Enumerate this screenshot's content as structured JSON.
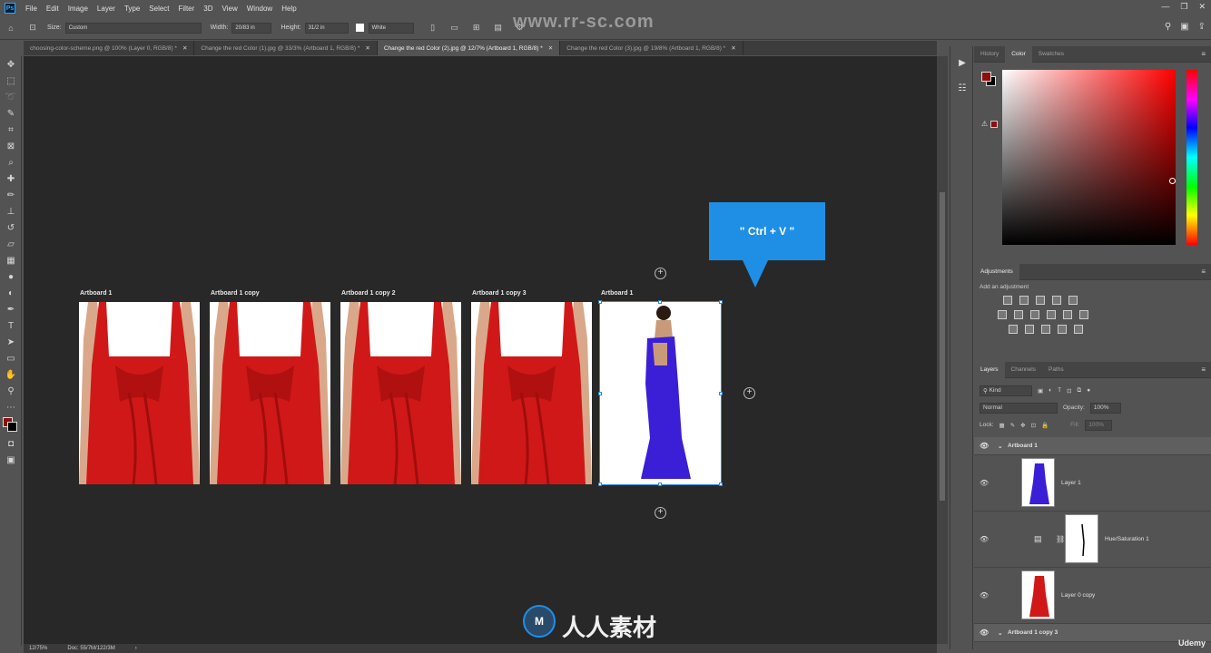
{
  "menubar": {
    "items": [
      "File",
      "Edit",
      "Image",
      "Layer",
      "Type",
      "Select",
      "Filter",
      "3D",
      "View",
      "Window",
      "Help"
    ]
  },
  "options": {
    "size_label": "Size:",
    "size_value": "Custom",
    "width_label": "Width:",
    "width_value": "20/83 in",
    "height_label": "Height:",
    "height_value": "31/2 in",
    "bg_value": "White"
  },
  "watermark_url": "www.rr-sc.com",
  "tabs": [
    "choosing-color-scheme.png @ 100% (Layer 0, RGB/8) *",
    "Change the red Color (1).jpg @ 33/3% (Artboard 1, RGB/8) *",
    "Change the red Color (2).jpg @ 12/7% (Artboard 1, RGB/8) *",
    "Change the red Color (3).jpg @ 19/8% (Artboard 1, RGB/8) *"
  ],
  "artboards": [
    "Artboard 1",
    "Artboard 1 copy",
    "Artboard 1 copy 2",
    "Artboard 1 copy 3",
    "Artboard 1"
  ],
  "callout": "\" Ctrl + V \"",
  "status": {
    "zoom": "12/75%",
    "doc": "Doc: 55/7M/122/3M"
  },
  "logo_text": "人人素材",
  "panels": {
    "top_tabs": [
      "History",
      "Color",
      "Swatches"
    ],
    "adjustments_title": "Adjustments",
    "add_adjustment": "Add an adjustment",
    "layer_tabs": [
      "Layers",
      "Channels",
      "Paths"
    ],
    "kind": "Kind",
    "blend_mode": "Normal",
    "opacity_label": "Opacity:",
    "opacity_value": "100%",
    "lock_label": "Lock:",
    "fill_label": "Fill:",
    "fill_value": "100%"
  },
  "layers": [
    {
      "name": "Artboard 1",
      "type": "group"
    },
    {
      "name": "Layer 1",
      "type": "layer"
    },
    {
      "name": "Hue/Saturation 1",
      "type": "adjustment"
    },
    {
      "name": "Layer 0 copy",
      "type": "layer"
    },
    {
      "name": "Artboard 1 copy 3",
      "type": "group"
    }
  ],
  "udemy": "Udemy",
  "colors": {
    "accent": "#1f8fe6",
    "dress_red": "#d01818",
    "dress_blue": "#3a1fd6",
    "foreground": "#8a1010"
  }
}
